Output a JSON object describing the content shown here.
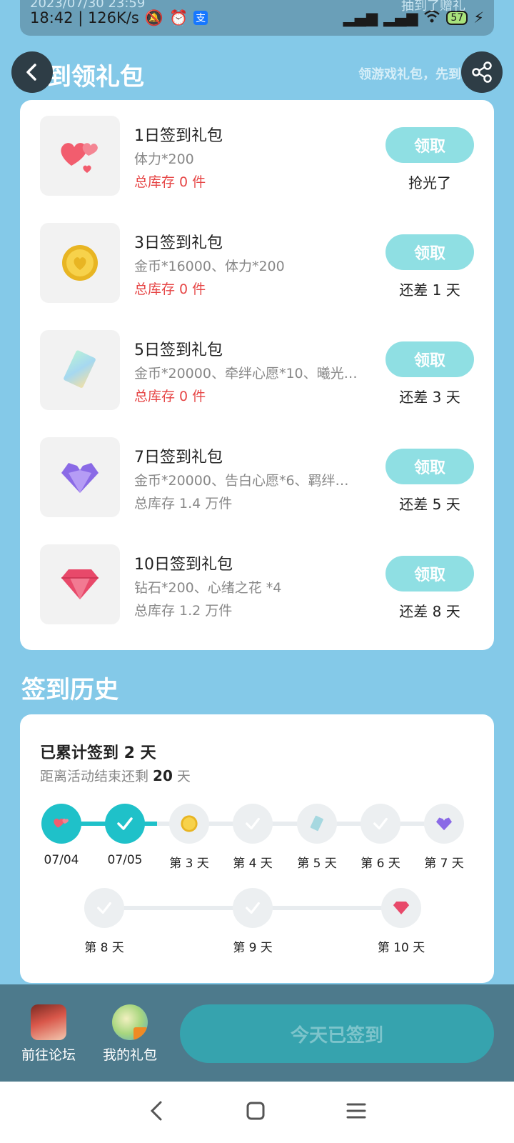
{
  "status_bar": {
    "time_speed": "18:42 | 126K/s",
    "battery": "57",
    "ghost_left": "2023/07/30 23:59",
    "ghost_right": "抽到了赠礼"
  },
  "header": {
    "title": "签到领礼包",
    "subtitle": "领游戏礼包，先到"
  },
  "gifts": [
    {
      "name": "1日签到礼包",
      "desc": "体力*200",
      "stock": "总库存 0 件",
      "button": "领取",
      "status": "抢光了"
    },
    {
      "name": "3日签到礼包",
      "desc": "金币*16000、体力*200",
      "stock": "总库存 0 件",
      "button": "领取",
      "status": "还差 1 天"
    },
    {
      "name": "5日签到礼包",
      "desc": "金币*20000、牵绊心愿*10、曦光…",
      "stock": "总库存 0 件",
      "button": "领取",
      "status": "还差 3 天"
    },
    {
      "name": "7日签到礼包",
      "desc": "金币*20000、告白心愿*6、羁绊…",
      "stock": "总库存 1.4 万件",
      "button": "领取",
      "status": "还差 5 天"
    },
    {
      "name": "10日签到礼包",
      "desc": "钻石*200、心绪之花 *4",
      "stock": "总库存 1.2 万件",
      "button": "领取",
      "status": "还差 8 天"
    }
  ],
  "history": {
    "title": "签到历史",
    "count_prefix": "已累计签到 ",
    "count_value": "2",
    "count_suffix": " 天",
    "remain_prefix": "距离活动结束还剩 ",
    "remain_value": "20",
    "remain_suffix": " 天",
    "days": [
      "07/04",
      "07/05",
      "第 3 天",
      "第 4 天",
      "第 5 天",
      "第 6 天",
      "第 7 天",
      "第 8 天",
      "第 9 天",
      "第 10 天"
    ]
  },
  "bottom": {
    "forum": "前往论坛",
    "my_gifts": "我的礼包",
    "signed": "今天已签到"
  },
  "colors": {
    "background": "#84c9e8",
    "accent": "#1fc1c9",
    "claim_button": "#8fdfe3",
    "stock_out": "#e64545"
  }
}
